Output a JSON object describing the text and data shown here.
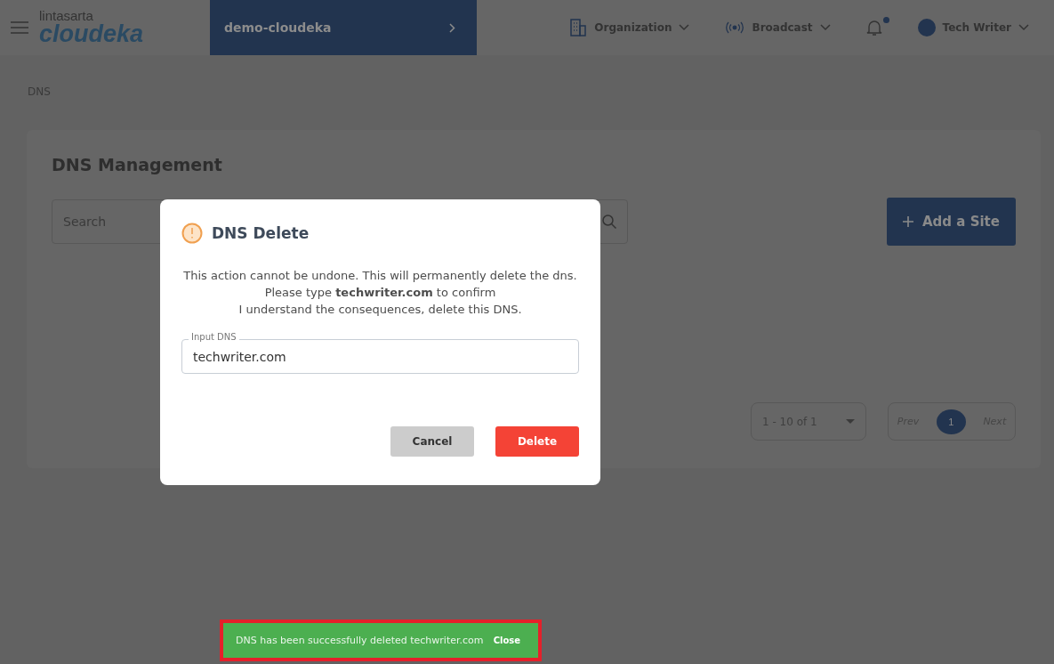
{
  "header": {
    "brand_top": "lintasarta",
    "brand_main": "cloudeka",
    "project": "demo-cloudeka",
    "nav": [
      {
        "label": "Organization",
        "kind": "org"
      },
      {
        "label": "Broadcast",
        "kind": "broadcast"
      }
    ],
    "notification_unread": true,
    "user": "Tech Writer"
  },
  "breadcrumb": "DNS",
  "card": {
    "title": "DNS Management",
    "search": {
      "placeholder": "Search"
    },
    "add_button": "Add a Site",
    "page_size": "1 - 10 of 1",
    "prev": "Prev",
    "next": "Next",
    "pages": [
      {
        "label": "1",
        "selected": true
      }
    ]
  },
  "dialog": {
    "title": "DNS Delete",
    "lines": [
      "This action cannot be undone. This will permanently delete the dns.",
      "Please type **techwriter.com** to confirm",
      "I understand the consequences, delete this DNS."
    ],
    "field": {
      "label": "Input DNS",
      "value": "techwriter.com"
    },
    "cancel": "Cancel",
    "confirm": "Delete"
  },
  "toast": {
    "message": "DNS has been successfully deleted techwriter.com",
    "action": "Close",
    "highlighted": true
  }
}
